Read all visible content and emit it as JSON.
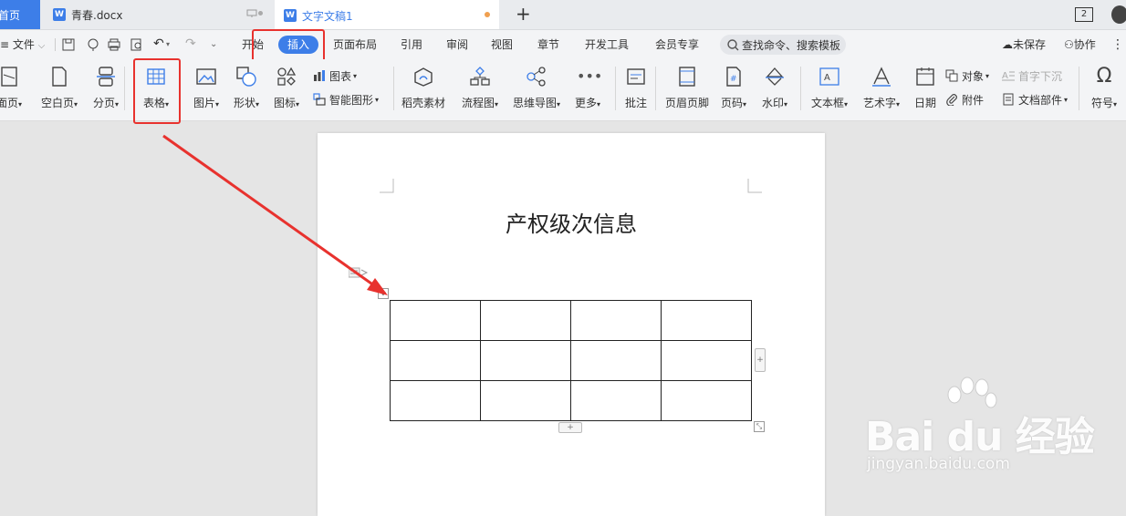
{
  "tabs": {
    "home": "首页",
    "doc1": "青春.docx",
    "doc2": "文字文稿1",
    "new_tab": "+",
    "window_count": "2"
  },
  "menu": {
    "file": "文件",
    "items": [
      "开始",
      "插入",
      "页面布局",
      "引用",
      "审阅",
      "视图",
      "章节",
      "开发工具",
      "会员专享"
    ],
    "active": "插入",
    "search_placeholder": "查找命令、搜索模板",
    "unsaved": "未保存",
    "collab": "协作"
  },
  "ribbon": {
    "cover": "面页",
    "blank_page": "空白页",
    "page_break": "分页",
    "table": "表格",
    "picture": "图片",
    "shape": "形状",
    "icon": "图标",
    "chart": "图表",
    "smart_shape": "智能图形",
    "material": "稻壳素材",
    "flowchart": "流程图",
    "mindmap": "思维导图",
    "more": "更多",
    "comment": "批注",
    "header_footer": "页眉页脚",
    "page_number": "页码",
    "watermark": "水印",
    "textbox": "文本框",
    "wordart": "艺术字",
    "date": "日期",
    "object": "对象",
    "attachment": "附件",
    "drop_cap": "首字下沉",
    "doc_parts": "文档部件",
    "symbol": "符号"
  },
  "document": {
    "title": "产权级次信息",
    "table": {
      "rows": 3,
      "cols": 4
    }
  },
  "watermark": {
    "brand": "Bai du 经验",
    "url": "jingyan.baidu.com"
  },
  "colors": {
    "accent": "#3d7ee8",
    "annotation_red": "#e8322e"
  }
}
